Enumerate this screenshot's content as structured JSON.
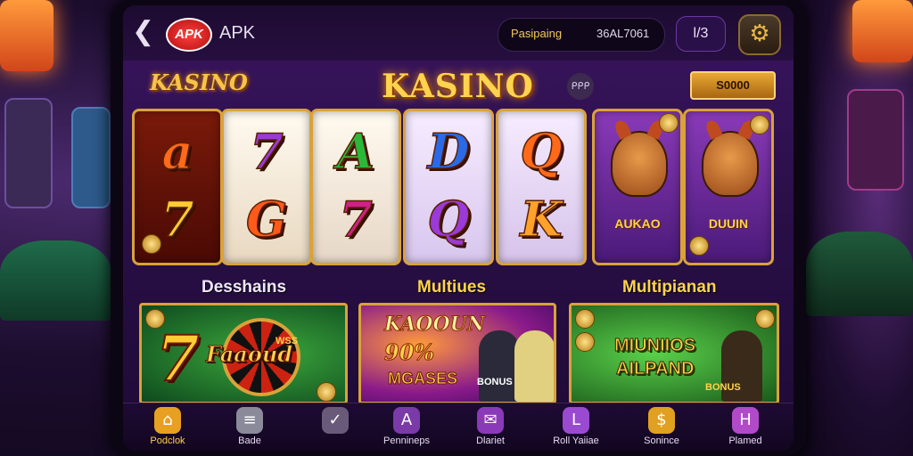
{
  "header": {
    "back_glyph": "❮",
    "logo_text": "APK",
    "app_name": "APK",
    "balance_label": "Pasipaing",
    "balance_value": "36AL7061",
    "id_button": "l/3",
    "settings_icon": "gear-icon"
  },
  "title_row": {
    "brand_small": "KASINO",
    "title": "KASINO",
    "badge": "ᑭᑭᑭ",
    "bonus_button": "S0000"
  },
  "reels": [
    {
      "top": "a",
      "bottom": "7",
      "top_color": "#ff6a1a",
      "bottom_color": "#ffcc33"
    },
    {
      "top": "7",
      "bottom": "G",
      "top_color": "#9a3ad8",
      "bottom_color": "#ff5a1a"
    },
    {
      "top": "A",
      "bottom": "7",
      "top_color": "#2ab83a",
      "bottom_color": "#d0208a"
    },
    {
      "top": "D",
      "bottom": "Q",
      "top_color": "#2a6ae8",
      "bottom_color": "#9a3ad8"
    },
    {
      "top": "Q",
      "bottom": "K",
      "top_color": "#ff6a1a",
      "bottom_color": "#ffa22a"
    }
  ],
  "characters": [
    {
      "label": "AUKAO"
    },
    {
      "label": "DUUIN"
    }
  ],
  "sections": {
    "left": "Desshains",
    "middle": "Multiues",
    "right": "Multipianan"
  },
  "promos": {
    "card1": {
      "big": "7",
      "text": "Faaoud",
      "small": "WSS"
    },
    "card2": {
      "line1": "KAOOUN",
      "line2": "90%",
      "line3": "MGASES",
      "tag": "BONUS"
    },
    "card3": {
      "line1": "MIUNIIOS",
      "line2": "AILPAND",
      "tag": "BONUS"
    }
  },
  "nav": [
    {
      "label": "Podclok",
      "icon": "home-icon",
      "glyph": "⌂",
      "color": "#e8a022",
      "active": true
    },
    {
      "label": "Bade",
      "icon": "chips-icon",
      "glyph": "≡",
      "color": "#8a8a9a"
    },
    {
      "label": "",
      "icon": "flag-icon",
      "glyph": "✓",
      "color": "#6a5a7a"
    },
    {
      "label": "Pennineps",
      "icon": "ticket-icon",
      "glyph": "A",
      "color": "#7a3aa8"
    },
    {
      "label": "Dlariet",
      "icon": "envelope-icon",
      "glyph": "✉",
      "color": "#8a3ab8"
    },
    {
      "label": "Roll Yaiiae",
      "icon": "wallet-icon",
      "glyph": "L",
      "color": "#9a4ad0"
    },
    {
      "label": "Sonince",
      "icon": "coin-icon",
      "glyph": "$",
      "color": "#e0a020"
    },
    {
      "label": "Plamed",
      "icon": "gift-icon",
      "glyph": "H",
      "color": "#b04ac8"
    }
  ]
}
